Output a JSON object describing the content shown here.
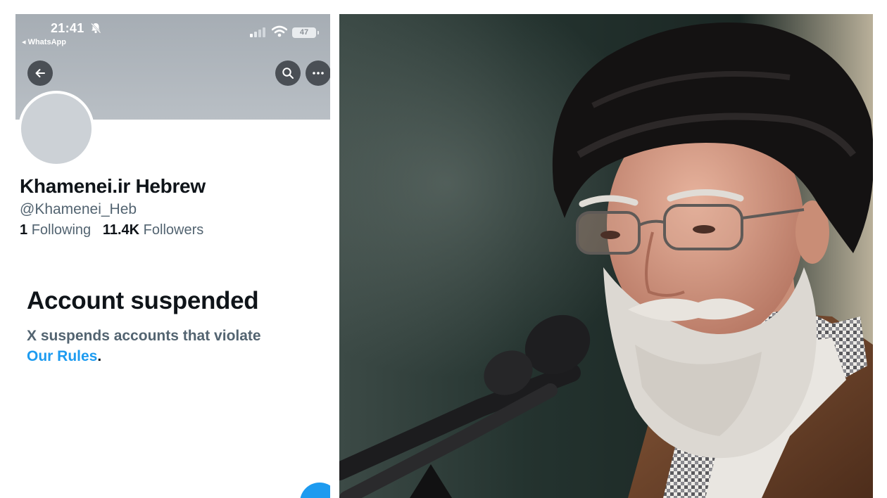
{
  "status_bar": {
    "time": "21:41",
    "back_app": "◂ WhatsApp",
    "battery": "47"
  },
  "header": {
    "back_icon": "arrow-left-icon",
    "search_icon": "search-icon",
    "more_icon": "more-horizontal-icon"
  },
  "profile": {
    "display_name": "Khamenei.ir Hebrew",
    "handle": "@Khamenei_Heb",
    "following_count": "1",
    "following_label": "Following",
    "followers_count": "11.4K",
    "followers_label": "Followers"
  },
  "suspension": {
    "title": "Account suspended",
    "message": "X suspends accounts that violate",
    "link_text": "Our Rules",
    "trailing": "."
  },
  "colors": {
    "banner": "#b0b6bc",
    "link": "#1d9bf0",
    "text_primary": "#0f1419",
    "text_secondary": "#536471"
  }
}
